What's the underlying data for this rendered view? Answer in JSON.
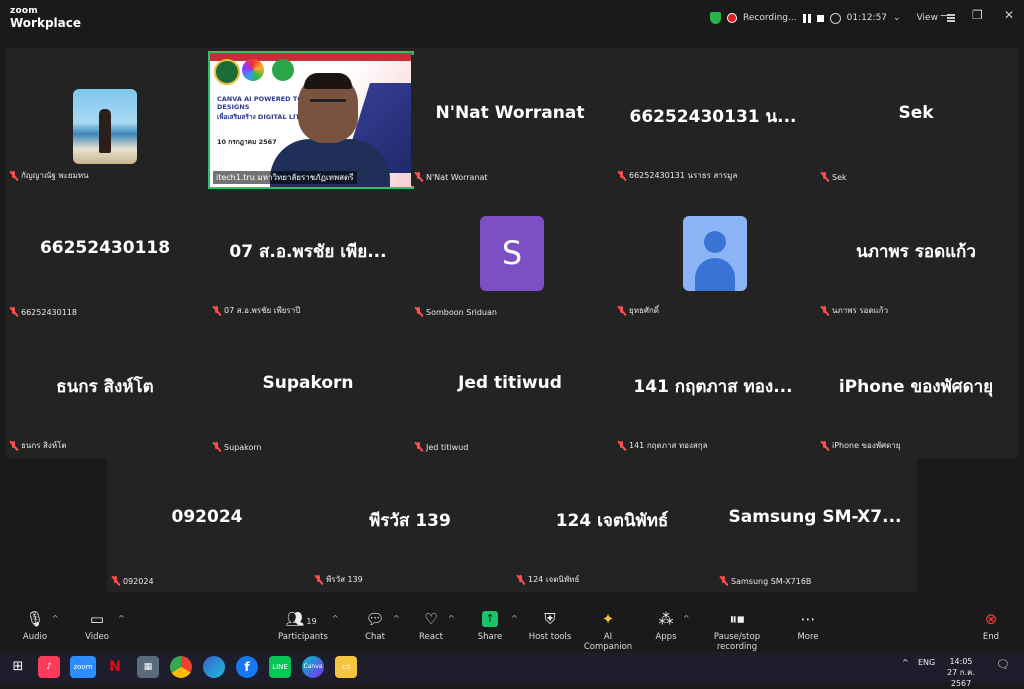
{
  "app": {
    "brand_line1": "zoom",
    "brand_line2": "Workplace"
  },
  "header": {
    "recording_label": "Recording...",
    "timer": "01:12:57",
    "view_label": "View"
  },
  "presenter": {
    "label": "itech1.tru มหาวิทยาลัยราชภัฏเทพสตรี",
    "slide_line1": "CANVA AI POWERED TO CREAT",
    "slide_line2": "DESIGNS",
    "slide_line3": "เพื่อเสริมสร้าง DIGITAL LITERA",
    "slide_date": "10 กรกฎาคม 2567"
  },
  "tiles": [
    {
      "id": "kanyanat",
      "name": "",
      "label": "กัญญาณัฐ พะยมหน",
      "avatar": "photo"
    },
    {
      "id": "nnat",
      "name": "N'Nat Worranat",
      "label": "N'Nat Worranat"
    },
    {
      "id": "s66252430131",
      "name": "66252430131 น...",
      "label": "66252430131 นราธร สารมูล"
    },
    {
      "id": "sek",
      "name": "Sek",
      "label": "Sek"
    },
    {
      "id": "s66252430118",
      "name": "66252430118",
      "label": "66252430118"
    },
    {
      "id": "s07",
      "name": "07 ส.อ.พรชัย เพีย...",
      "label": "07 ส.อ.พรชัย เพียราปี"
    },
    {
      "id": "somboon",
      "name": "",
      "label": "Somboon Sriduan",
      "avatar": "S"
    },
    {
      "id": "yutsak",
      "name": "",
      "label": "ยุทธศักดิ์",
      "avatar": "person"
    },
    {
      "id": "naphaporn",
      "name": "นภาพร รอดแก้ว",
      "label": "นภาพร รอดแก้ว"
    },
    {
      "id": "thanakorn",
      "name": "ธนกร สิงห์โต",
      "label": "ธนกร สิงห์โต"
    },
    {
      "id": "supakorn",
      "name": "Supakorn",
      "label": "Supakorn"
    },
    {
      "id": "jed",
      "name": "Jed titiwud",
      "label": "Jed titiwud"
    },
    {
      "id": "s141",
      "name": "141 กฤตภาส ทอง...",
      "label": "141 กฤตภาส ทองสกุล"
    },
    {
      "id": "iphone",
      "name": "iPhone ของพัศดายุ",
      "label": "iPhone ของพัศดายุ"
    },
    {
      "id": "s092024",
      "name": "092024",
      "label": "092024"
    },
    {
      "id": "peerawat",
      "name": "พีรวัส 139",
      "label": "พีรวัส 139"
    },
    {
      "id": "s124",
      "name": "124 เจตนิพัทธ์",
      "label": "124 เจตนิพัทธ์"
    },
    {
      "id": "samsung",
      "name": "Samsung  SM-X7...",
      "label": "Samsung SM-X716B"
    }
  ],
  "toolbar": {
    "audio": "Audio",
    "video": "Video",
    "participants": "Participants",
    "participants_count": "19",
    "chat": "Chat",
    "react": "React",
    "share": "Share",
    "host_tools": "Host tools",
    "ai_companion": "AI Companion",
    "apps": "Apps",
    "pause_stop": "Pause/stop recording",
    "more": "More",
    "end": "End"
  },
  "taskbar": {
    "lang": "ENG",
    "time": "14:05",
    "date": "27 ก.ค. 2567"
  },
  "colors": {
    "active_speaker": "#27c46b",
    "muted": "#ff4d4d",
    "end": "#ff3b3b",
    "share": "#1ec26b"
  }
}
